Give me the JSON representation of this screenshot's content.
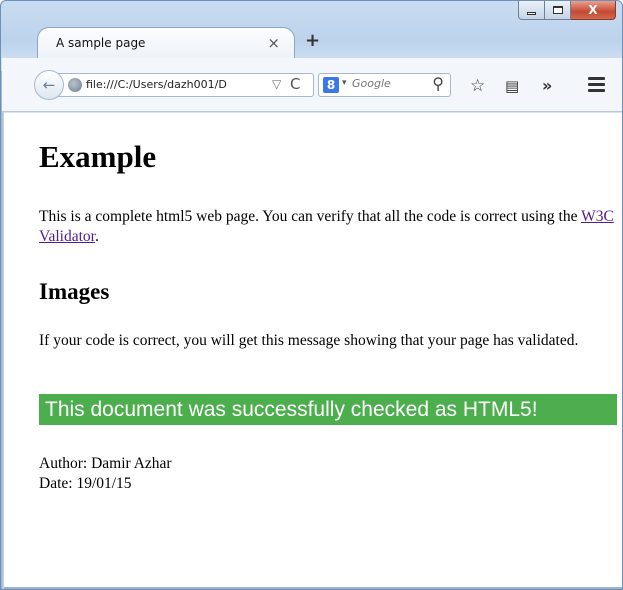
{
  "window": {
    "caption_buttons": {
      "minimize_icon": "minimize-icon",
      "maximize_icon": "maximize-icon",
      "close_label": "X"
    }
  },
  "tabs": [
    {
      "title": "A sample page",
      "close_label": "×"
    }
  ],
  "new_tab_label": "+",
  "toolbar": {
    "url": "file:///C:/Users/dazh001/D",
    "dropdown_glyph": "▽",
    "reload_glyph": "C",
    "search_engine_badge": "8",
    "search_caret": "▾",
    "search_placeholder": "Google",
    "search_glyph": "⚲",
    "bookmark_glyph": "☆",
    "reader_glyph": "▤",
    "overflow_glyph": "»",
    "back_glyph": "←"
  },
  "page": {
    "heading": "Example",
    "intro_before_link": "This is a complete html5 web page. You can verify that all the code is correct using the ",
    "intro_link": "W3C Validator",
    "intro_after_link": ".",
    "subheading": "Images",
    "image_paragraph": "If your code is correct, you will get this message showing that your page has validated.",
    "validation_badge": "This document was successfully checked as HTML5!",
    "author": "Author: Damir Azhar",
    "date": "Date: 19/01/15"
  },
  "colors": {
    "badge_bg": "#4cae4c",
    "link": "#551a8b",
    "close_button": "#c44a31",
    "frame": "#c9dcf1"
  }
}
